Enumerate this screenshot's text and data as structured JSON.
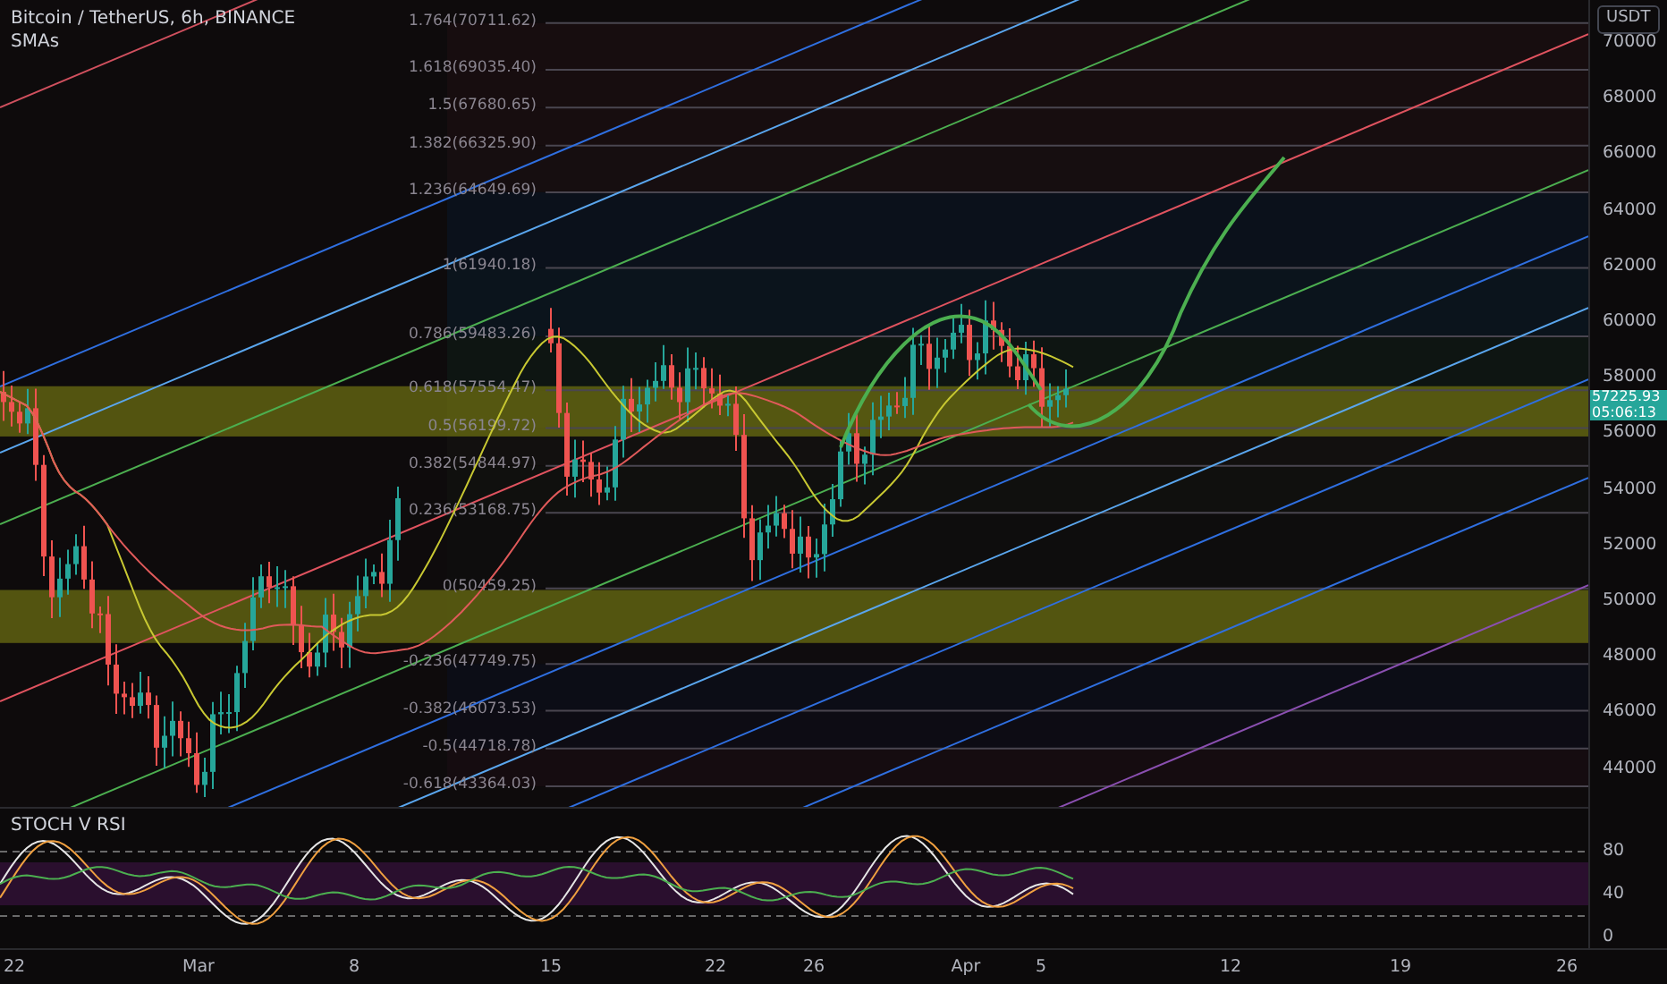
{
  "chart": {
    "title": "Bitcoin / TetherUS, 6h, BINANCE",
    "indicator": "SMAs",
    "fib_levels": [
      {
        "label": "1.764(70711.62)"
      },
      {
        "label": "1.618(69035.40)"
      },
      {
        "label": "1.5(67680.65)"
      },
      {
        "label": "1.382(66325.90)"
      },
      {
        "label": "1.236(64649.69)"
      },
      {
        "label": "1(61940.18)"
      },
      {
        "label": "0.786(59483.26)"
      },
      {
        "label": "0.618(57554.47)"
      },
      {
        "label": "0.5(56199.72)"
      },
      {
        "label": "0.382(54844.97)"
      },
      {
        "label": "0.236(53168.75)"
      },
      {
        "label": "0(50459.25)"
      },
      {
        "label": "-0.236(47749.75)"
      },
      {
        "label": "-0.382(46073.53)"
      },
      {
        "label": "-0.5(44718.78)"
      },
      {
        "label": "-0.618(43364.03)"
      }
    ]
  },
  "price_axis": {
    "unit": "USDT",
    "ticks": [
      "70000",
      "68000",
      "66000",
      "64000",
      "62000",
      "60000",
      "58000",
      "56000",
      "54000",
      "52000",
      "50000",
      "48000",
      "46000",
      "44000"
    ],
    "last_price": {
      "price": "57225.93",
      "countdown": "05:06:13"
    }
  },
  "oscillator": {
    "title": "STOCH V RSI",
    "ticks": [
      "80",
      "40",
      "0"
    ]
  },
  "time_axis": [
    "22",
    "Mar",
    "8",
    "15",
    "22",
    "26",
    "Apr",
    "5",
    "12",
    "19",
    "26"
  ]
}
